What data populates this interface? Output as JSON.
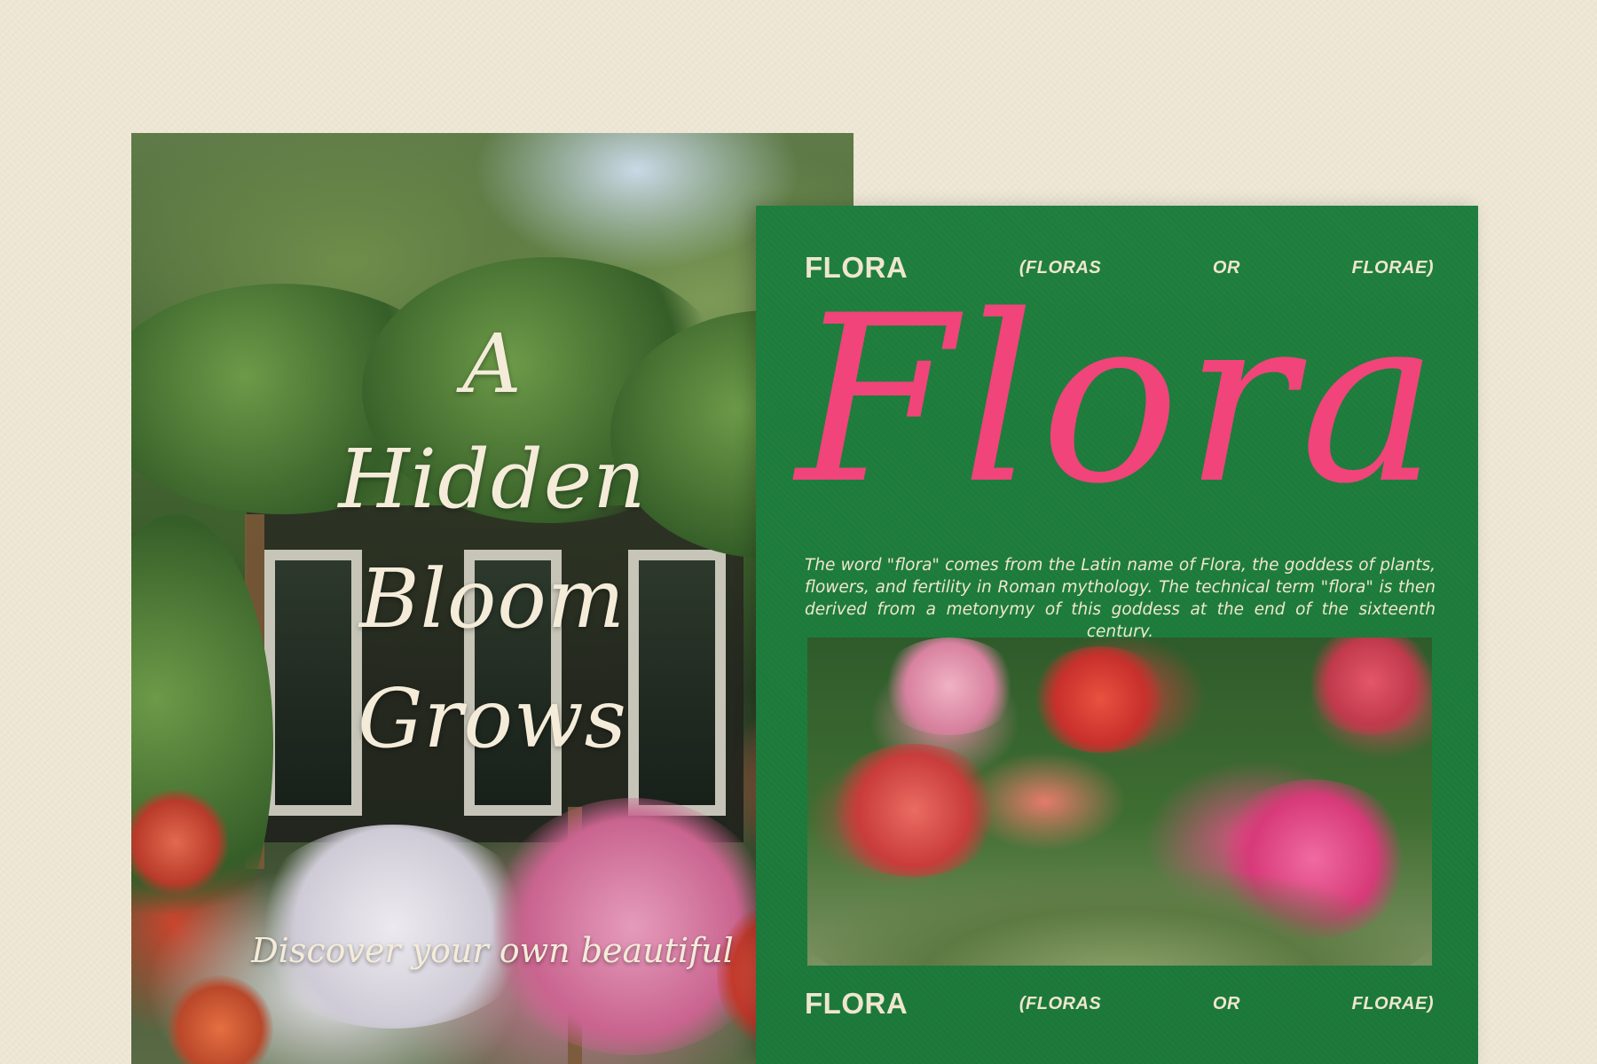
{
  "left_poster": {
    "title_lines": [
      "A",
      "Hidden",
      "Bloom",
      "Grows"
    ],
    "tagline": "Discover your own beautiful"
  },
  "right_poster": {
    "header": {
      "brand": "FLORA",
      "meta_1": "(FLORAS",
      "meta_2": "OR",
      "meta_3": "FLORAE)"
    },
    "big_title": "Flora",
    "description": "The word \"flora\" comes from the Latin name of Flora, the goddess of plants, flowers, and fertility in Roman mythology. The technical term \"flora\" is then derived from a metonymy of this goddess at the end of the sixteenth century.",
    "footer": {
      "brand": "FLORA",
      "meta_1": "(FLORAS",
      "meta_2": "OR",
      "meta_3": "FLORAE)"
    }
  },
  "colors": {
    "background": "#efe8d6",
    "poster_green": "#1f7a3e",
    "script_pink": "#f0447a",
    "cream_text": "#efe6cf"
  }
}
